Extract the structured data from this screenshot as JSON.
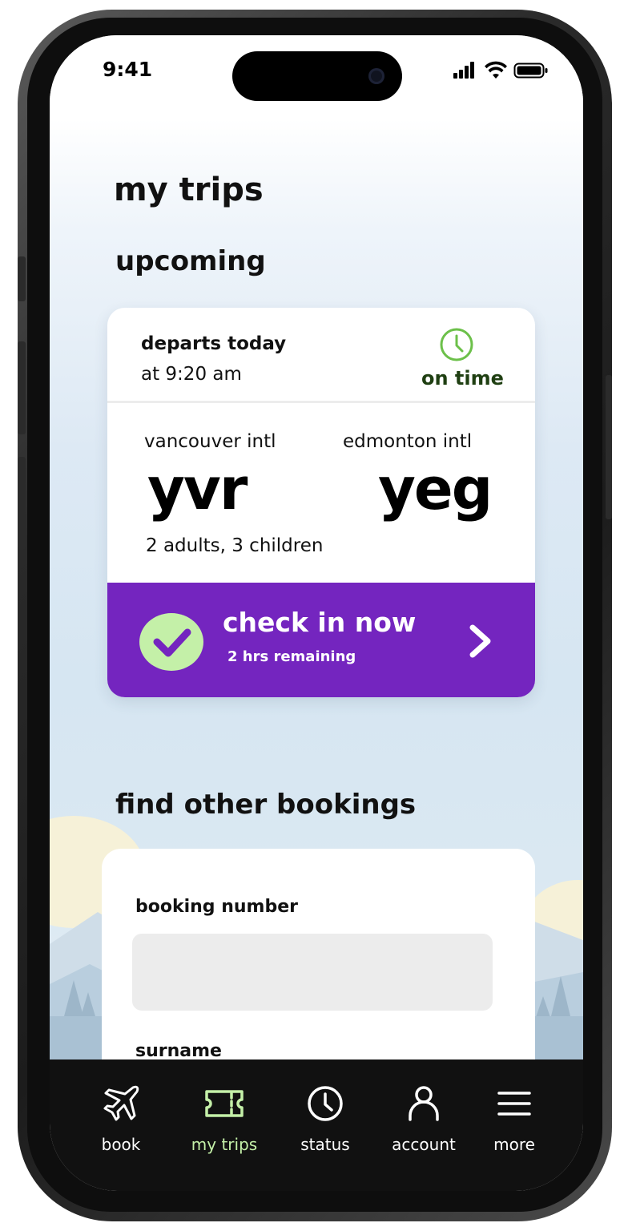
{
  "status_bar": {
    "time": "9:41"
  },
  "page": {
    "title": "my trips"
  },
  "upcoming": {
    "heading": "upcoming",
    "trip": {
      "departs_label": "departs today",
      "departs_time": "at 9:20 am",
      "status": "on time",
      "status_icon": "clock-icon",
      "origin": {
        "name": "vancouver intl",
        "code": "yvr"
      },
      "destination": {
        "name": "edmonton intl",
        "code": "yeg"
      },
      "passengers": "2 adults, 3 children",
      "checkin": {
        "label": "check in now",
        "remaining": "2 hrs remaining"
      }
    }
  },
  "find_bookings": {
    "heading": "find other bookings",
    "booking_number_label": "booking number",
    "booking_number_value": "",
    "surname_label": "surname",
    "surname_value": ""
  },
  "tab_bar": {
    "tabs": [
      {
        "label": "book",
        "icon": "airplane-icon"
      },
      {
        "label": "my trips",
        "icon": "ticket-icon",
        "active": true
      },
      {
        "label": "status",
        "icon": "clock-icon"
      },
      {
        "label": "account",
        "icon": "person-icon"
      },
      {
        "label": "more",
        "icon": "hamburger-menu-icon"
      }
    ]
  },
  "colors": {
    "brand_purple": "#7425bf",
    "accent_green": "#c4f0a8",
    "clock_green": "#6cc04a",
    "on_time_text": "#1f3f12",
    "tab_bar_bg": "#111111",
    "input_bg": "#ececec"
  }
}
